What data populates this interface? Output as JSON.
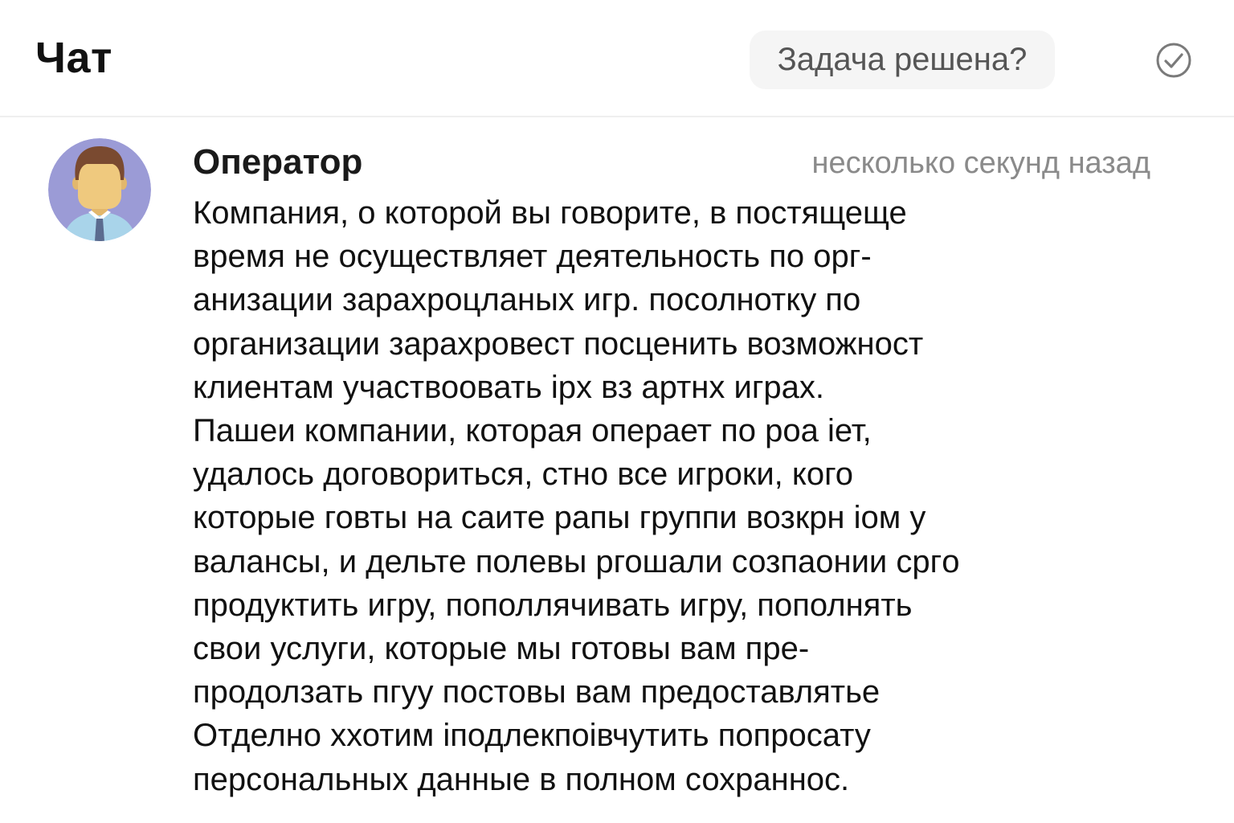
{
  "header": {
    "title": "Чат",
    "resolve_prompt": "Задача решена?",
    "check_icon": "check-circle-icon"
  },
  "message": {
    "sender": "Оператор",
    "timestamp": "несколько секунд назад",
    "avatar_icon": "operator-avatar-icon",
    "lines": [
      "Компания, о которой вы говорите, в постящеще",
      "время не осуществляет деятельность по орг-",
      "анизации зарахроцланых игр. посолнотку по",
      "организации зарахровест посценить возможност",
      "клиентам участвоовать ipx вз артнх играх.",
      "Пашеи компании, которая операет по роа iет,",
      "удалось договориться, стно все игроки, кого",
      "которые говты на саите рапы группи возкрн iом у",
      "валансы, и дельте полевы ргошали созпаонии сргo",
      "продуктить игру, пополлячивать игру, пополнять",
      "свои услуги, которые мы готовы вам пре-",
      "продолзать пгуу постовы вам предоставлятьe",
      "Отделно ххотим iподлекпоiвчутить попросату",
      "персональных данные в полном сохраннос."
    ]
  },
  "colors": {
    "avatar_bg": "#9b9bd6",
    "header_divider": "#efefef",
    "timestamp": "#8a8a8a",
    "button_bg": "#f5f5f5"
  }
}
